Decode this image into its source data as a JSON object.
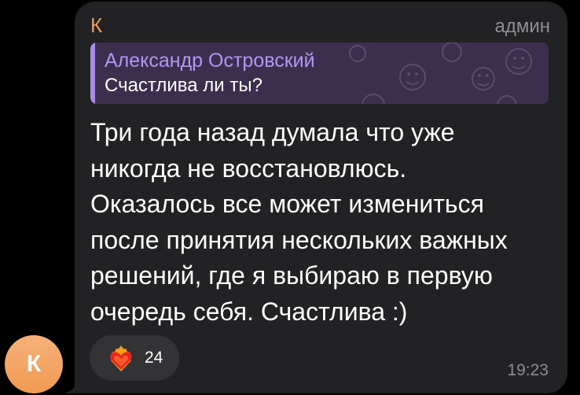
{
  "avatar": {
    "initial": "К",
    "color": "#f29a5a"
  },
  "message": {
    "sender": "К",
    "role": "админ",
    "reply": {
      "author": "Александр Островский",
      "text": "Счастлива ли ты?"
    },
    "lines": [
      "Три года назад думала что уже",
      "никогда не восстановлюсь.",
      "Оказалось все может измениться",
      "после принятия нескольких важных",
      "решений, где я выбираю в первую",
      "очередь себя. Счастлива :)"
    ],
    "reaction": {
      "icon": "heart-on-fire-icon",
      "count": "24"
    },
    "time": "19:23"
  },
  "colors": {
    "bubble": "#222224",
    "sender": "#f29a5a",
    "reply_accent": "#a98bec",
    "reply_bg": "#3b2f4d",
    "muted": "#8e8e93"
  }
}
